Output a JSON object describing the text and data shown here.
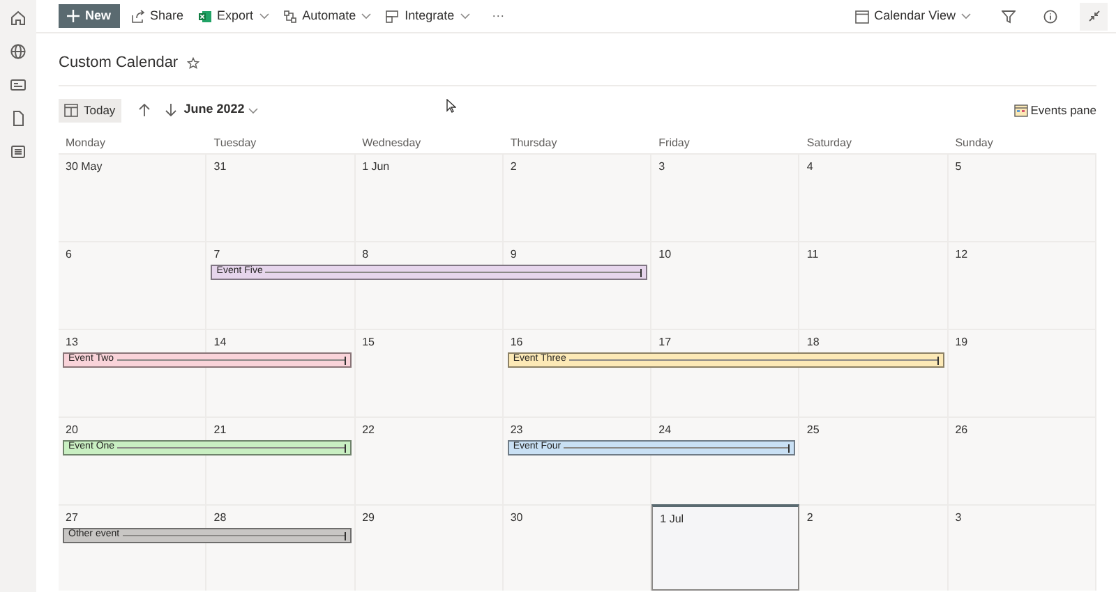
{
  "toolbar": {
    "new_button": "New",
    "commands": [
      {
        "label": "Share",
        "kind": "share",
        "dropdown": false
      },
      {
        "label": "Export",
        "kind": "excel",
        "dropdown": true
      },
      {
        "label": "Automate",
        "kind": "flow",
        "dropdown": true
      },
      {
        "label": "Integrate",
        "kind": "integrate",
        "dropdown": true
      }
    ],
    "more": "···",
    "view": "Calendar View"
  },
  "title": "Custom Calendar",
  "nav": {
    "today": "Today",
    "month": "June 2022",
    "events_pane": "Events pane"
  },
  "weekdays": [
    "Monday",
    "Tuesday",
    "Wednesday",
    "Thursday",
    "Friday",
    "Saturday",
    "Sunday"
  ],
  "weeks": [
    {
      "days": [
        {
          "label": "30 May",
          "today": false,
          "continues": false
        },
        {
          "label": "31",
          "today": false,
          "continues": false
        },
        {
          "label": "1 Jun",
          "today": false,
          "continues": false
        },
        {
          "label": "2",
          "today": false,
          "continues": false
        },
        {
          "label": "3",
          "today": false,
          "continues": false
        },
        {
          "label": "4",
          "today": false,
          "continues": false
        },
        {
          "label": "5",
          "today": false,
          "continues": false
        }
      ]
    },
    {
      "days": [
        {
          "label": "6",
          "today": false,
          "continues": false
        },
        {
          "label": "7",
          "today": false,
          "continues": false,
          "event": {
            "title": "Event Five",
            "color": "#e6d5ec"
          }
        },
        {
          "label": "8",
          "today": false,
          "continues": true
        },
        {
          "label": "9",
          "today": false,
          "continues": true
        },
        {
          "label": "10",
          "today": false,
          "continues": false
        },
        {
          "label": "11",
          "today": false,
          "continues": false
        },
        {
          "label": "12",
          "today": false,
          "continues": false
        }
      ]
    },
    {
      "days": [
        {
          "label": "13",
          "today": false,
          "continues": false,
          "event": {
            "title": "Event Two",
            "color": "#f9d3d9"
          }
        },
        {
          "label": "14",
          "today": false,
          "continues": true
        },
        {
          "label": "15",
          "today": false,
          "continues": false
        },
        {
          "label": "16",
          "today": false,
          "continues": false,
          "event": {
            "title": "Event Three",
            "color": "#fce9b6"
          }
        },
        {
          "label": "17",
          "today": false,
          "continues": true
        },
        {
          "label": "18",
          "today": false,
          "continues": true
        },
        {
          "label": "19",
          "today": false,
          "continues": false
        }
      ]
    },
    {
      "days": [
        {
          "label": "20",
          "today": false,
          "continues": false,
          "event": {
            "title": "Event One",
            "color": "#c9efc2"
          }
        },
        {
          "label": "21",
          "today": false,
          "continues": true
        },
        {
          "label": "22",
          "today": false,
          "continues": false
        },
        {
          "label": "23",
          "today": false,
          "continues": false,
          "event": {
            "title": "Event Four",
            "color": "#c9e0f4"
          }
        },
        {
          "label": "24",
          "today": false,
          "continues": true
        },
        {
          "label": "25",
          "today": false,
          "continues": false
        },
        {
          "label": "26",
          "today": false,
          "continues": false
        }
      ]
    },
    {
      "days": [
        {
          "label": "27",
          "today": false,
          "continues": false,
          "event": {
            "title": "Other event",
            "color": "#c8c6c4"
          }
        },
        {
          "label": "28",
          "today": false,
          "continues": true
        },
        {
          "label": "29",
          "today": false,
          "continues": false
        },
        {
          "label": "30",
          "today": false,
          "continues": false
        },
        {
          "label": "1 Jul",
          "today": true,
          "continues": false
        },
        {
          "label": "2",
          "today": false,
          "continues": false
        },
        {
          "label": "3",
          "today": false,
          "continues": false
        }
      ]
    }
  ]
}
